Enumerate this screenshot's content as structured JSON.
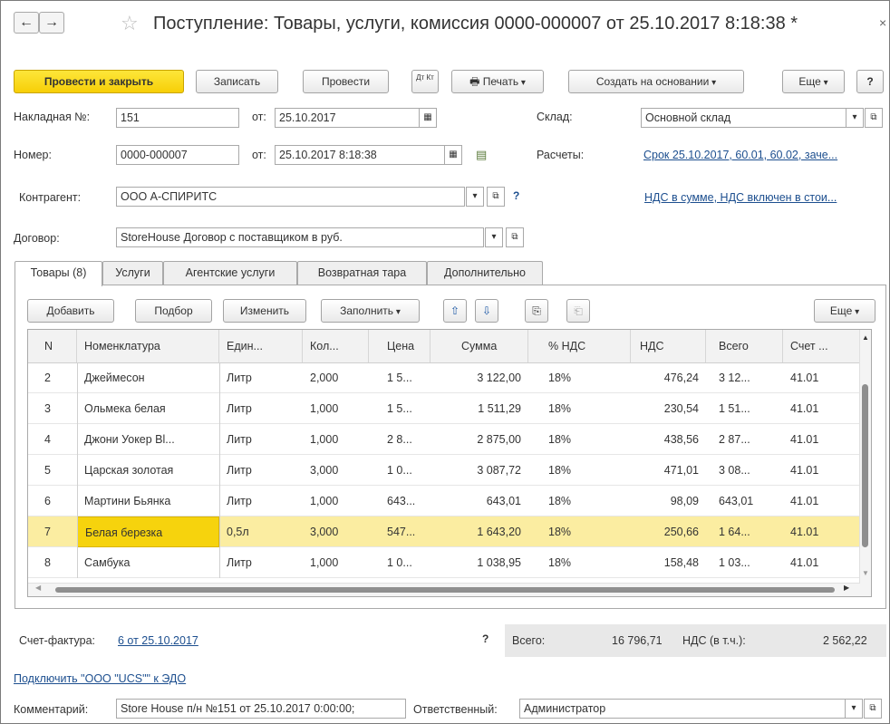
{
  "window": {
    "title": "Поступление: Товары, услуги, комиссия 0000-000007 от 25.10.2017 8:18:38 *",
    "back_icon": "←",
    "forward_icon": "→",
    "close_icon": "×"
  },
  "toolbar": {
    "post_close": "Провести и закрыть",
    "save": "Записать",
    "post": "Провести",
    "dtkt": "Дт Кт",
    "print": "Печать",
    "create_based": "Создать на основании",
    "more": "Еще",
    "help": "?"
  },
  "header": {
    "invoice_label": "Накладная №:",
    "invoice_number": "151",
    "from_label": "от:",
    "invoice_date": "25.10.2017",
    "warehouse_label": "Склад:",
    "warehouse_value": "Основной склад",
    "number_label": "Номер:",
    "number_value": "0000-000007",
    "number_from_label": "от:",
    "number_date": "25.10.2017  8:18:38",
    "settlements_label": "Расчеты:",
    "settlements_link": "Срок 25.10.2017, 60.01, 60.02, заче...",
    "counterparty_label": "Контрагент:",
    "counterparty_value": "ООО А-СПИРИТС",
    "counterparty_help": "?",
    "vat_link": "НДС в сумме, НДС включен в стои...",
    "contract_label": "Договор:",
    "contract_value": "StoreHouse Договор с поставщиком в руб."
  },
  "tabs": [
    {
      "label": "Товары (8)"
    },
    {
      "label": "Услуги"
    },
    {
      "label": "Агентские услуги"
    },
    {
      "label": "Возвратная тара"
    },
    {
      "label": "Дополнительно"
    }
  ],
  "table_toolbar": {
    "add": "Добавить",
    "pick": "Подбор",
    "change": "Изменить",
    "fill": "Заполнить",
    "more": "Еще"
  },
  "table": {
    "columns": [
      "N",
      "Номенклатура",
      "Един...",
      "Кол...",
      "Цена",
      "Сумма",
      "% НДС",
      "НДС",
      "Всего",
      "Счет ..."
    ],
    "rows": [
      {
        "n": "2",
        "name": "Джеймесон",
        "unit": "Литр",
        "qty": "2,000",
        "price": "1 5...",
        "sum": "3 122,00",
        "vat_rate": "18%",
        "vat": "476,24",
        "total": "3 12...",
        "account": "41.01"
      },
      {
        "n": "3",
        "name": "Ольмека белая",
        "unit": "Литр",
        "qty": "1,000",
        "price": "1 5...",
        "sum": "1 511,29",
        "vat_rate": "18%",
        "vat": "230,54",
        "total": "1 51...",
        "account": "41.01"
      },
      {
        "n": "4",
        "name": "Джони Уокер Bl...",
        "unit": "Литр",
        "qty": "1,000",
        "price": "2 8...",
        "sum": "2 875,00",
        "vat_rate": "18%",
        "vat": "438,56",
        "total": "2 87...",
        "account": "41.01"
      },
      {
        "n": "5",
        "name": "Царская золотая",
        "unit": "Литр",
        "qty": "3,000",
        "price": "1 0...",
        "sum": "3 087,72",
        "vat_rate": "18%",
        "vat": "471,01",
        "total": "3 08...",
        "account": "41.01"
      },
      {
        "n": "6",
        "name": "Мартини Бьянка",
        "unit": "Литр",
        "qty": "1,000",
        "price": "643...",
        "sum": "643,01",
        "vat_rate": "18%",
        "vat": "98,09",
        "total": "643,01",
        "account": "41.01"
      },
      {
        "n": "7",
        "name": "Белая березка",
        "unit": "0,5л",
        "qty": "3,000",
        "price": "547...",
        "sum": "1 643,20",
        "vat_rate": "18%",
        "vat": "250,66",
        "total": "1 64...",
        "account": "41.01"
      },
      {
        "n": "8",
        "name": "Самбука",
        "unit": "Литр",
        "qty": "1,000",
        "price": "1 0...",
        "sum": "1 038,95",
        "vat_rate": "18%",
        "vat": "158,48",
        "total": "1 03...",
        "account": "41.01"
      }
    ]
  },
  "footer": {
    "invoice_label": "Счет-фактура:",
    "invoice_link": "6 от 25.10.2017",
    "help": "?",
    "total_label": "Всего:",
    "total_value": "16 796,71",
    "vat_label": "НДС (в т.ч.):",
    "vat_value": "2 562,22",
    "edo_link": "Подключить \"ООО \"UCS\"\" к ЭДО",
    "comment_label": "Комментарий:",
    "comment_value": "Store House п/н №151 от 25.10.2017 0:00:00;",
    "responsible_label": "Ответственный:",
    "responsible_value": "Администратор"
  }
}
